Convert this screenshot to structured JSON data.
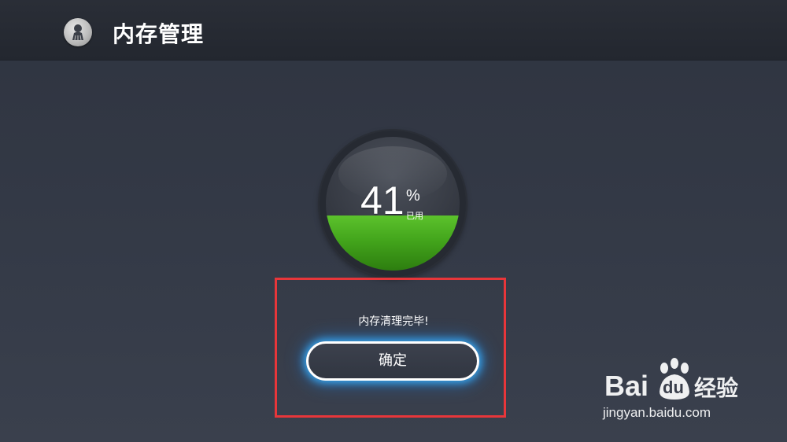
{
  "header": {
    "title": "内存管理",
    "icon": "broom-clean-icon"
  },
  "gauge": {
    "value": "41",
    "unit": "%",
    "used_label": "已用",
    "fill_percent": 41,
    "fill_color": "#4fb324"
  },
  "dialog": {
    "message": "内存清理完毕!",
    "ok_label": "确定",
    "highlight_color": "#e8363a",
    "button_glow_color": "#38b2ff"
  },
  "watermark": {
    "brand_text": "Bai",
    "du_text": "du",
    "product_text": "经验",
    "url": "jingyan.baidu.com"
  }
}
